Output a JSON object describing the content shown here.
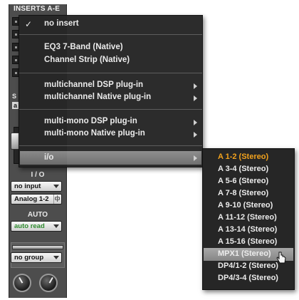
{
  "strip": {
    "title": "INSERTS A-E",
    "letters": [
      "S",
      "a"
    ],
    "io_label": "I / O",
    "input_value": "no input",
    "output_value": "Analog 1-2",
    "phase_glyph": "ф",
    "auto_label": "AUTO",
    "auto_value": "auto read",
    "group_value": "no group"
  },
  "menu": {
    "checkmark": "✓",
    "items": [
      "no insert",
      "EQ3 7-Band (Native)",
      "Channel Strip (Native)",
      "multichannel DSP plug-in",
      "multichannel Native plug-in",
      "multi-mono DSP plug-in",
      "multi-mono Native plug-in",
      "i/o"
    ]
  },
  "submenu": {
    "items": [
      "A 1-2 (Stereo)",
      "A 3-4 (Stereo)",
      "A 5-6 (Stereo)",
      "A 7-8 (Stereo)",
      "A 9-10 (Stereo)",
      "A 11-12 (Stereo)",
      "A 13-14 (Stereo)",
      "A 15-16 (Stereo)",
      "MPX1 (Stereo)",
      "DP4/1-2 (Stereo)",
      "DP4/3-4 (Stereo)"
    ],
    "active_color": "#f2a21d"
  }
}
